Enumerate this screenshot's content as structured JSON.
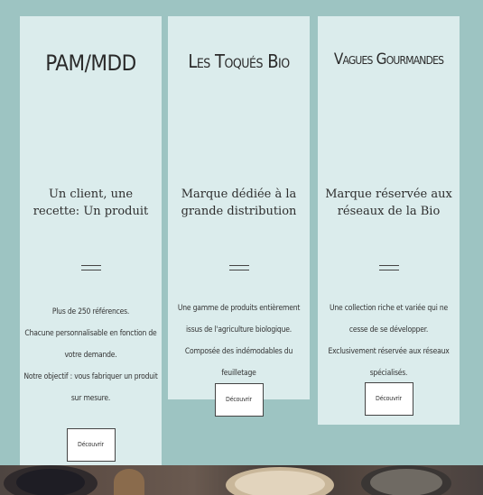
{
  "cards": [
    {
      "title": "PAM/MDD",
      "subtitle": "Un client, une recette: Un produit",
      "description": [
        "Plus de 250 références.",
        "Chacune personnalisable en fonction de votre demande.",
        "Notre objectif : vous fabriquer un produit sur mesure."
      ],
      "button": "Découvrir"
    },
    {
      "title": "Les Toqués Bio",
      "subtitle": "Marque dédiée à la grande distribution",
      "description": [
        "Une gamme de produits entièrement issus de l'agriculture biologique.",
        "Composée des indémodables du feuilletage"
      ],
      "button": "Découvrir"
    },
    {
      "title": "Vagues Gourmandes",
      "subtitle": "Marque réservée aux réseaux de la Bio",
      "description": [
        "Une collection riche et variée qui ne cesse de se développer.",
        "Exclusivement réservée aux réseaux spécialisés."
      ],
      "button": "Découvrir"
    }
  ],
  "colors": {
    "background": "#9dc4c2",
    "card": "#dbecec",
    "button": "#ffffff"
  }
}
